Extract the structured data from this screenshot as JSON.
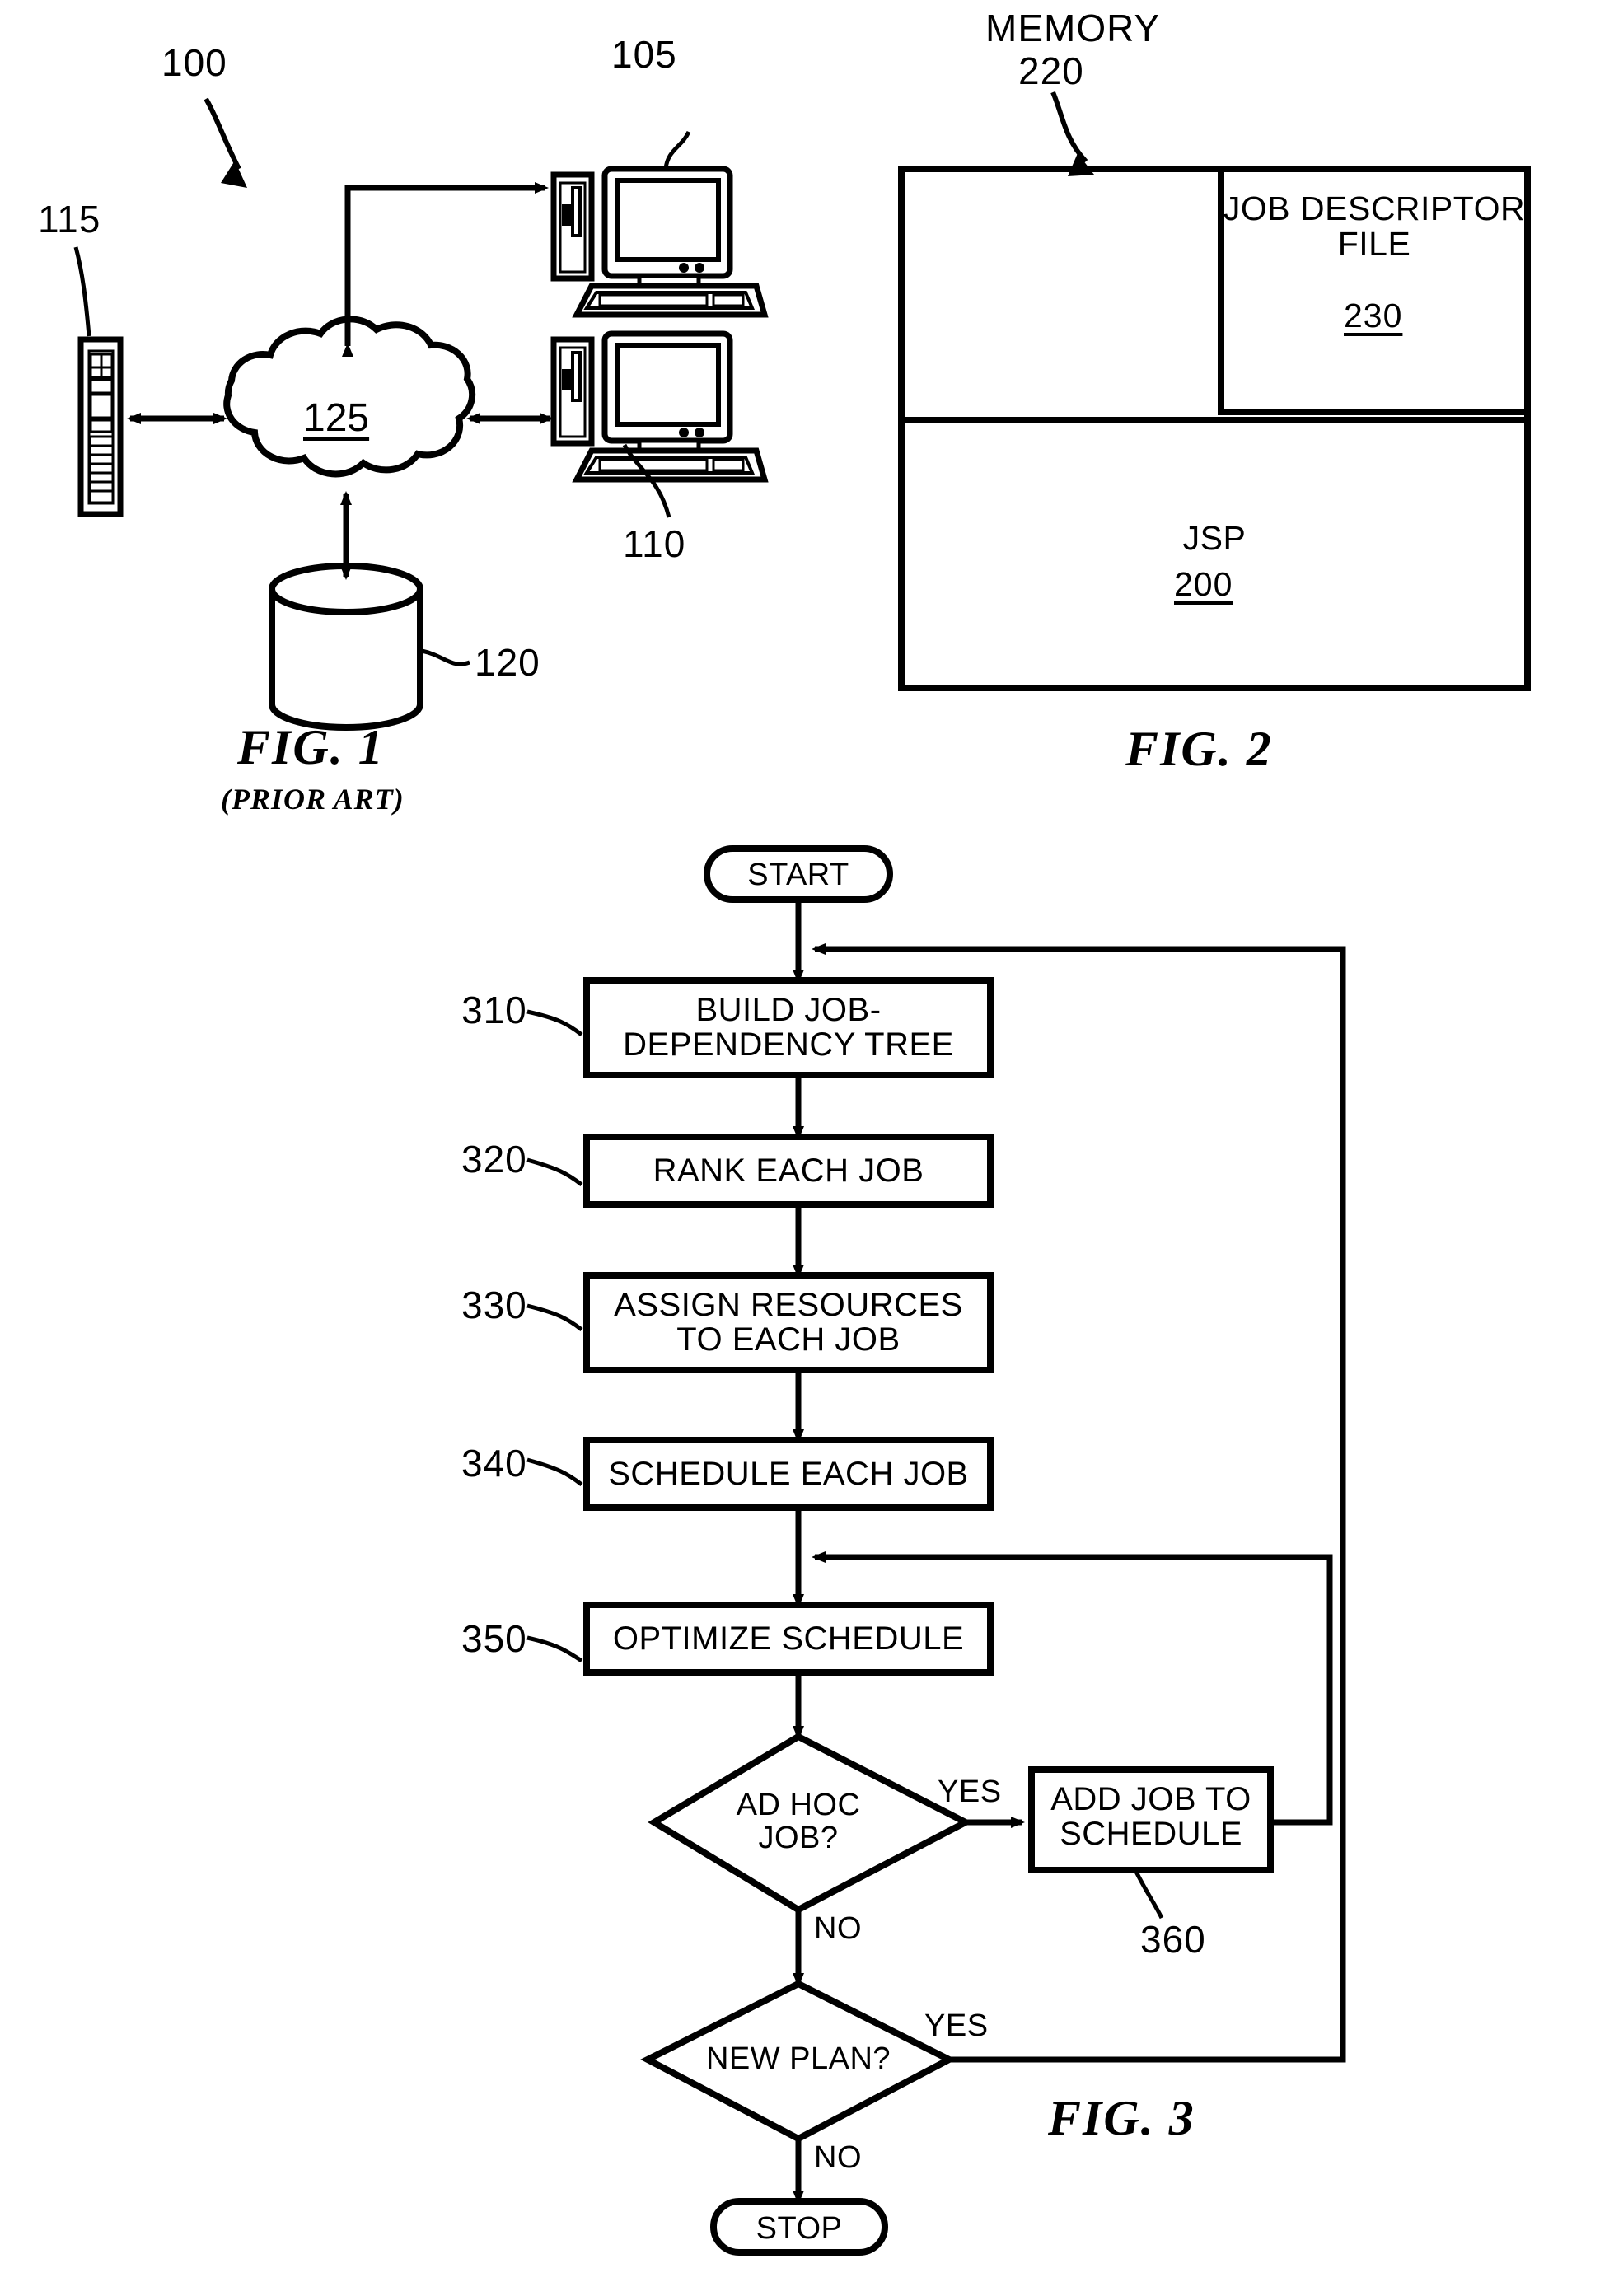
{
  "document": {
    "type": "patent-drawing-sheet",
    "figures": [
      "FIG. 1",
      "FIG. 2",
      "FIG. 3"
    ]
  },
  "figure1": {
    "title": "FIG. 1",
    "subtitle": "(PRIOR ART)",
    "system_ref": "100",
    "nodes": [
      {
        "id": "client1",
        "ref": "105",
        "icon": "desktop-computer-icon"
      },
      {
        "id": "client2",
        "ref": "110",
        "icon": "desktop-computer-icon"
      },
      {
        "id": "server",
        "ref": "115",
        "icon": "server-rack-icon"
      },
      {
        "id": "database",
        "ref": "120",
        "icon": "database-cylinder-icon"
      },
      {
        "id": "network",
        "ref": "125",
        "icon": "cloud-icon"
      }
    ]
  },
  "figure2": {
    "title": "FIG. 2",
    "memory_label": "MEMORY",
    "memory_ref": "220",
    "blocks": [
      {
        "id": "job-descriptor-file",
        "line1": "JOB DESCRIPTOR",
        "line2": "FILE",
        "ref": "230"
      },
      {
        "id": "jsp",
        "line1": "JSP",
        "ref": "200"
      }
    ]
  },
  "figure3": {
    "title": "FIG. 3",
    "terminals": {
      "start": "START",
      "stop": "STOP"
    },
    "steps": [
      {
        "ref": "310",
        "line1": "BUILD JOB-",
        "line2": "DEPENDENCY TREE"
      },
      {
        "ref": "320",
        "line1": "RANK EACH JOB"
      },
      {
        "ref": "330",
        "line1": "ASSIGN RESOURCES",
        "line2": "TO EACH JOB"
      },
      {
        "ref": "340",
        "line1": "SCHEDULE EACH JOB"
      },
      {
        "ref": "350",
        "line1": "OPTIMIZE SCHEDULE"
      },
      {
        "ref": "360",
        "line1": "ADD JOB TO",
        "line2": "SCHEDULE"
      }
    ],
    "decisions": [
      {
        "id": "ad-hoc-job",
        "line1": "AD HOC",
        "line2": "JOB?",
        "yes": "YES",
        "no": "NO"
      },
      {
        "id": "new-plan",
        "line1": "NEW PLAN?",
        "yes": "YES",
        "no": "NO"
      }
    ]
  },
  "colors": {
    "ink": "#000000",
    "paper": "#ffffff"
  }
}
